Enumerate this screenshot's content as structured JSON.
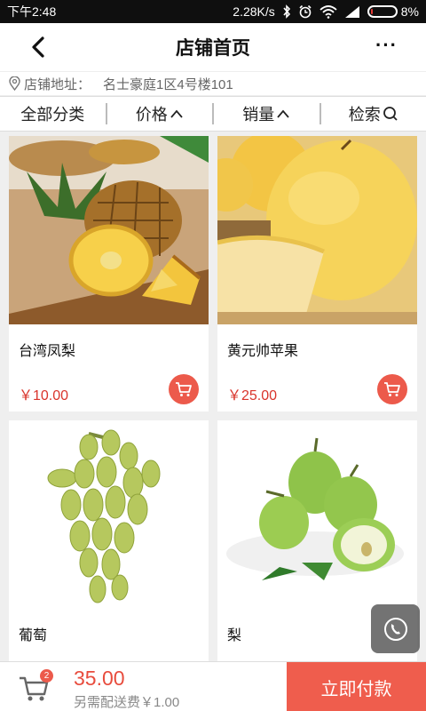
{
  "status": {
    "time": "下午2:48",
    "speed": "2.28K/s",
    "battery": "8%",
    "battery_level": 0.08
  },
  "header": {
    "title": "店铺首页",
    "more": "···"
  },
  "address": {
    "label": "店铺地址：",
    "value": "名士豪庭1区4号楼101"
  },
  "filters": [
    {
      "label": "全部分类"
    },
    {
      "label": "价格"
    },
    {
      "label": "销量"
    },
    {
      "label": "检索"
    }
  ],
  "products": [
    {
      "name": "台湾凤梨",
      "price": "￥10.00"
    },
    {
      "name": "黄元帅苹果",
      "price": "￥25.00"
    },
    {
      "name": "葡萄",
      "price": ""
    },
    {
      "name": "梨",
      "price": ""
    }
  ],
  "cart": {
    "badge": "2",
    "total": "35.00",
    "delivery_fee": "另需配送费￥1.00",
    "pay_label": "立即付款"
  },
  "colors": {
    "accent": "#ef5d4d",
    "price": "#d9342b"
  }
}
